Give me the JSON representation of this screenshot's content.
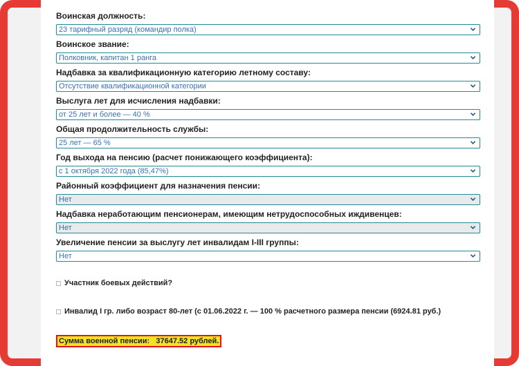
{
  "fields": [
    {
      "label": "Воинская должность:",
      "value": "23 тарифный разряд (командир полка)"
    },
    {
      "label": "Воинское звание:",
      "value": "Полковник, капитан 1 ранга"
    },
    {
      "label": "Надбавка за квалификационную категорию летному составу:",
      "value": "Отсутствие квалификационной категории"
    },
    {
      "label": "Выслуга лет для исчисления надбавки:",
      "value": "от 25 лет и более — 40 %"
    },
    {
      "label": "Общая продолжительность службы:",
      "value": "25 лет — 65 %"
    },
    {
      "label": "Год выхода на пенсию (расчет понижающего коэффициента):",
      "value": "с 1 октября 2022 года (85,47%)"
    },
    {
      "label": "Районный коэффициент для назначения пенсии:",
      "value": "Нет"
    },
    {
      "label": "Надбавка неработающим пенсионерам, имеющим нетрудоспособных иждивенцев:",
      "value": "Нет"
    },
    {
      "label": "Увеличение пенсии за выслугу лет инвалидам I-III группы:",
      "value": "Нет"
    }
  ],
  "checkboxes": [
    {
      "label": "Участник боевых действий?",
      "checked": false
    },
    {
      "label": "Инвалид I гр. либо возраст 80-лет (с 01.06.2022 г. — 100 % расчетного размера пенсии (6924.81 руб.)",
      "checked": false
    }
  ],
  "result": {
    "label": "Сумма военной пенсии:",
    "amount": "37647.52 рублей."
  },
  "colors": {
    "frame": "#e63a35",
    "select_border": "#1e8a93",
    "select_text": "#3a6fb5",
    "result_bg": "#f3e322",
    "result_border": "#e0161c"
  },
  "icons": {
    "dropdown": "chevron-down-icon",
    "checkbox": "checkbox-icon"
  }
}
